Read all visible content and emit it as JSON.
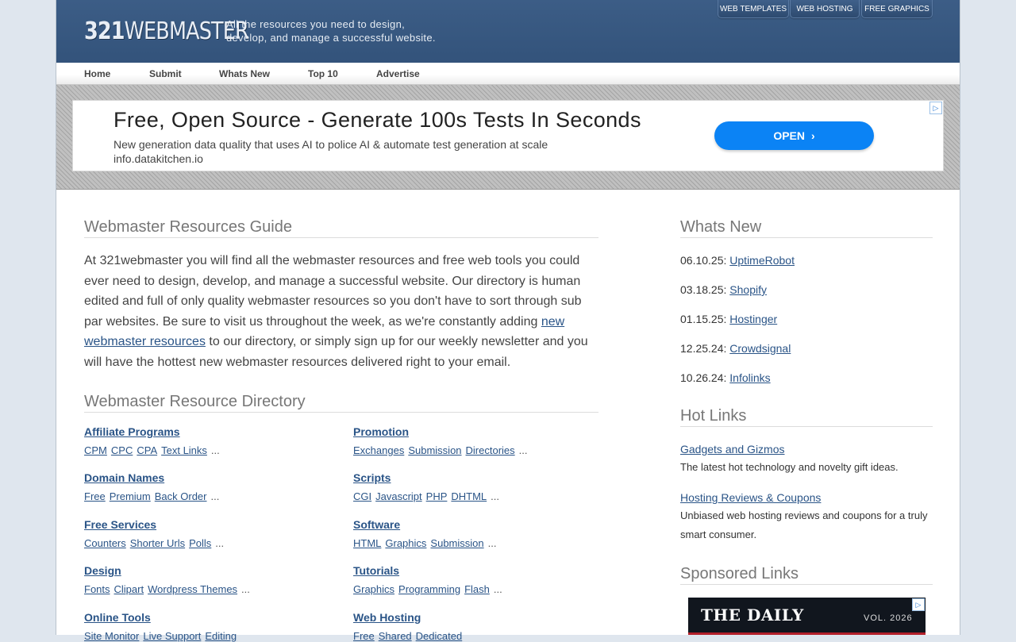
{
  "header": {
    "logo_text_bold": "321",
    "logo_text_thin": "WEBMASTER",
    "tagline_line1": "All the resources you need to design,",
    "tagline_line2": "develop, and manage a successful website.",
    "top_links": [
      "WEB TEMPLATES",
      "WEB HOSTING",
      "FREE GRAPHICS"
    ]
  },
  "nav": [
    "Home",
    "Submit",
    "Whats New",
    "Top 10",
    "Advertise"
  ],
  "ad": {
    "headline": "Free, Open Source - Generate 100s Tests In Seconds",
    "description": "New generation data quality that uses AI to police AI & automate test generation at scale",
    "domain": "info.datakitchen.io",
    "button": "OPEN",
    "chevron": "›",
    "choice_icon": "▷"
  },
  "main": {
    "guide_title": "Webmaster Resources Guide",
    "intro_part1": "At 321webmaster you will find all the webmaster resources and free web tools you could ever need to design, develop, and manage a successful website. Our directory is human edited and full of only quality webmaster resources so you don't have to sort through sub par websites. Be sure to visit us throughout the week, as we're constantly adding ",
    "intro_link": "new webmaster resources",
    "intro_part2": " to our directory, or simply sign up for our weekly newsletter and you will have the hottest new webmaster resources delivered right to your email.",
    "directory_title": "Webmaster Resource Directory",
    "more": "...",
    "categories": [
      {
        "title": "Affiliate Programs",
        "links": [
          "CPM",
          "CPC",
          "CPA",
          "Text Links"
        ]
      },
      {
        "title": "Promotion",
        "links": [
          "Exchanges",
          "Submission",
          "Directories"
        ]
      },
      {
        "title": "Domain Names",
        "links": [
          "Free",
          "Premium",
          "Back Order"
        ]
      },
      {
        "title": "Scripts",
        "links": [
          "CGI",
          "Javascript",
          "PHP",
          "DHTML"
        ]
      },
      {
        "title": "Free Services",
        "links": [
          "Counters",
          "Shorter Urls",
          "Polls"
        ]
      },
      {
        "title": "Software",
        "links": [
          "HTML",
          "Graphics",
          "Submission"
        ]
      },
      {
        "title": "Design",
        "links": [
          "Fonts",
          "Clipart",
          "Wordpress Themes"
        ]
      },
      {
        "title": "Tutorials",
        "links": [
          "Graphics",
          "Programming",
          "Flash"
        ]
      },
      {
        "title": "Online Tools",
        "links": [
          "Site Monitor",
          "Live Support",
          "Editing"
        ]
      },
      {
        "title": "Web Hosting",
        "links": [
          "Free",
          "Shared",
          "Dedicated"
        ]
      }
    ]
  },
  "sidebar": {
    "whats_new_title": "Whats New",
    "news": [
      {
        "date": "06.10.25:",
        "name": "UptimeRobot"
      },
      {
        "date": "03.18.25:",
        "name": "Shopify"
      },
      {
        "date": "01.15.25:",
        "name": "Hostinger"
      },
      {
        "date": "12.25.24:",
        "name": "Crowdsignal"
      },
      {
        "date": "10.26.24:",
        "name": "Infolinks"
      }
    ],
    "hot_links_title": "Hot Links",
    "hot_links": [
      {
        "title": "Gadgets and Gizmos",
        "desc": "The latest hot technology and novelty gift ideas."
      },
      {
        "title": "Hosting Reviews & Coupons",
        "desc": "Unbiased web hosting reviews and coupons for a truly smart consumer."
      }
    ],
    "sponsored_title": "Sponsored Links",
    "sponsored_ad": {
      "title": "THE DAILY",
      "vol": "VOL. 2026",
      "choice_icon": "▷"
    }
  }
}
